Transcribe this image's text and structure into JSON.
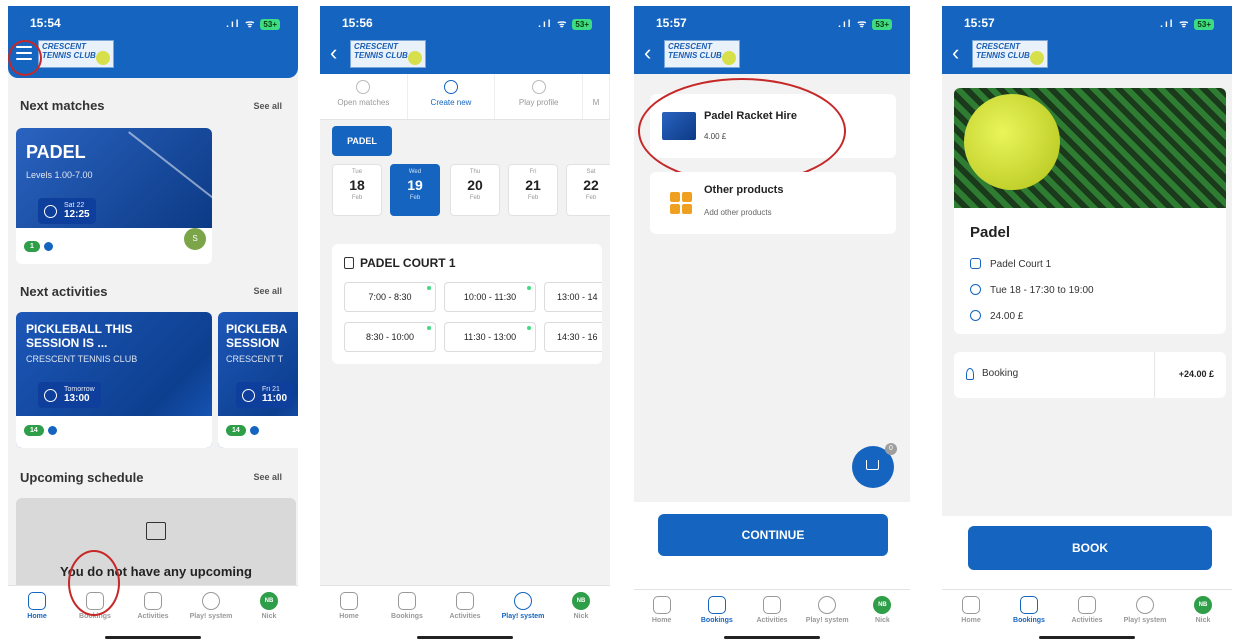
{
  "common": {
    "nav": [
      "Home",
      "Bookings",
      "Activities",
      "Play! system",
      "Nick"
    ],
    "nav_avatar": "NB",
    "logo_text": "CRESCENT TENNIS CLUB",
    "battery": "53+"
  },
  "phone1": {
    "time": "15:54",
    "next_matches": "Next matches",
    "see_all": "See all",
    "match_sport": "PADEL",
    "match_levels": "Levels 1.00-7.00",
    "match_date": "Sat 22",
    "match_time": "12:25",
    "match_pill": "1",
    "match_avatar": "S",
    "next_activities": "Next activities",
    "activity1_title": "PICKLEBALL THIS SESSION IS ...",
    "activity1_club": "CRESCENT TENNIS CLUB",
    "activity1_date": "Tomorrow",
    "activity1_time": "13:00",
    "activity1_pill": "14",
    "activity2_title": "PICKLEBA SESSION",
    "activity2_club": "CRESCENT T",
    "activity2_date": "Fri 21",
    "activity2_time": "11:00",
    "activity2_pill": "14",
    "upcoming": "Upcoming schedule",
    "empty": "You do not have any upcoming"
  },
  "phone2": {
    "time": "15:56",
    "tabs": [
      "Open matches",
      "Create new",
      "Play profile",
      "M"
    ],
    "sport": "PADEL",
    "days": [
      {
        "dow": "Tue",
        "num": "18",
        "mon": "Feb"
      },
      {
        "dow": "Wed",
        "num": "19",
        "mon": "Feb"
      },
      {
        "dow": "Thu",
        "num": "20",
        "mon": "Feb"
      },
      {
        "dow": "Fri",
        "num": "21",
        "mon": "Feb"
      },
      {
        "dow": "Sat",
        "num": "22",
        "mon": "Feb"
      }
    ],
    "court": "PADEL COURT 1",
    "slots": [
      "7:00 - 8:30",
      "10:00 - 11:30",
      "13:00 - 14",
      "8:30 - 10:00",
      "11:30 - 13:00",
      "14:30 - 16"
    ]
  },
  "phone3": {
    "time": "15:57",
    "product1_name": "Padel Racket Hire",
    "product1_price": "4.00 £",
    "product2_name": "Other products",
    "product2_desc": "Add other products",
    "cart_count": "0",
    "continue": "CONTINUE"
  },
  "phone4": {
    "time": "15:57",
    "title": "Padel",
    "court": "Padel Court 1",
    "when": "Tue 18 - 17:30 to 19:00",
    "price": "24.00 £",
    "booking_label": "Booking",
    "booking_amount": "+24.00 £",
    "book": "BOOK"
  }
}
